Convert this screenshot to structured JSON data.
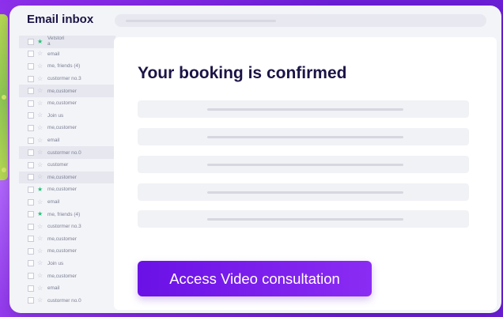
{
  "app": {
    "title": "Email inbox"
  },
  "inbox": {
    "items": [
      {
        "label": "Vetstori\na",
        "starred": true,
        "shaded": true
      },
      {
        "label": "email",
        "starred": false,
        "shaded": false
      },
      {
        "label": "me, friends (4)",
        "starred": false,
        "shaded": false
      },
      {
        "label": "custormer no.3",
        "starred": false,
        "shaded": false
      },
      {
        "label": "me,customer",
        "starred": false,
        "shaded": true
      },
      {
        "label": "me,customer",
        "starred": false,
        "shaded": false
      },
      {
        "label": "Join us",
        "starred": false,
        "shaded": false
      },
      {
        "label": "me,customer",
        "starred": false,
        "shaded": false
      },
      {
        "label": "email",
        "starred": false,
        "shaded": false
      },
      {
        "label": "custormer no.0",
        "starred": false,
        "shaded": true
      },
      {
        "label": "customer",
        "starred": false,
        "shaded": false
      },
      {
        "label": "me,customer",
        "starred": false,
        "shaded": true
      },
      {
        "label": "me,customer",
        "starred": true,
        "shaded": false
      },
      {
        "label": "email",
        "starred": false,
        "shaded": false
      },
      {
        "label": "me, friends (4)",
        "starred": true,
        "shaded": false
      },
      {
        "label": "custormer no.3",
        "starred": false,
        "shaded": false
      },
      {
        "label": "me,customer",
        "starred": false,
        "shaded": false
      },
      {
        "label": "me,customer",
        "starred": false,
        "shaded": false
      },
      {
        "label": "Join us",
        "starred": false,
        "shaded": false
      },
      {
        "label": "me,customer",
        "starred": false,
        "shaded": false
      },
      {
        "label": "email",
        "starred": false,
        "shaded": false
      },
      {
        "label": "custormer no.0",
        "starred": false,
        "shaded": false
      }
    ]
  },
  "email": {
    "heading": "Your booking is confirmed",
    "cta_label": "Access Video consultation"
  },
  "colors": {
    "accent": "#7b1fe8",
    "star_on": "#23c077",
    "heading": "#1b1446"
  },
  "icons": {
    "checkbox": "checkbox-icon",
    "star": "star-icon"
  }
}
